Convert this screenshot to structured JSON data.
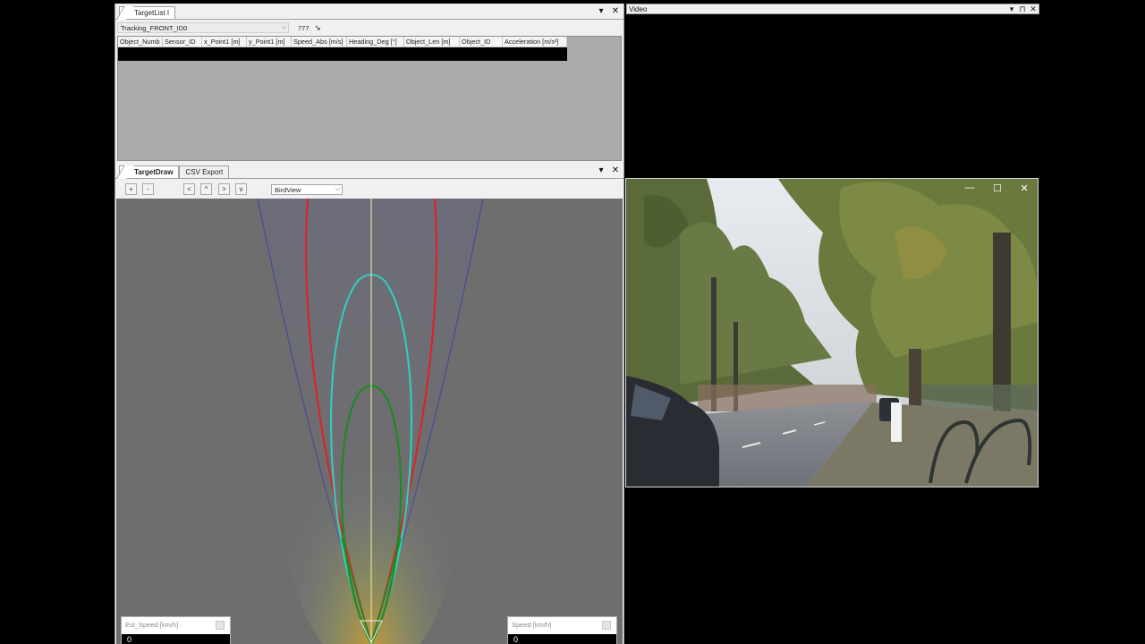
{
  "target_list": {
    "tab_label": "TargetList I",
    "source_select": "Tracking_FRONT_ID0",
    "count": "777",
    "columns": [
      "Object_Numb",
      "Sensor_ID",
      "x_Point1 [m]",
      "y_Point1 [m]",
      "Speed_Abs [m/s]",
      "Heading_Deg [°]",
      "Object_Len [m]",
      "Object_ID",
      "Acceleration [m/s²]"
    ]
  },
  "target_draw": {
    "tabs": [
      "TargetDraw",
      "CSV Export"
    ],
    "toolbar": {
      "zoom_in": "+",
      "zoom_out": "-",
      "pan_left": "<",
      "pan_up": "^",
      "pan_right": ">",
      "pan_down": "v",
      "view_mode": "BirdView"
    },
    "est_speed_label": "Est_Speed [km/h]",
    "est_speed_value": "0",
    "speed_label": "Speed [km/h]",
    "speed_value": "0"
  },
  "video": {
    "title": "Video"
  },
  "pane_controls": {
    "menu": "▾",
    "pin": "⊓",
    "close": "✕"
  },
  "window_controls": {
    "minimize": "—",
    "maximize": "☐",
    "close": "✕"
  },
  "colors": {
    "canvas_bg": "#6e6e6e",
    "red_boundary": "#e02020",
    "cyan_zone": "#30d0c0",
    "green_zone": "#1f8a1f",
    "blue_outline": "#4a4a9a",
    "center_line": "#f0f0a0"
  }
}
